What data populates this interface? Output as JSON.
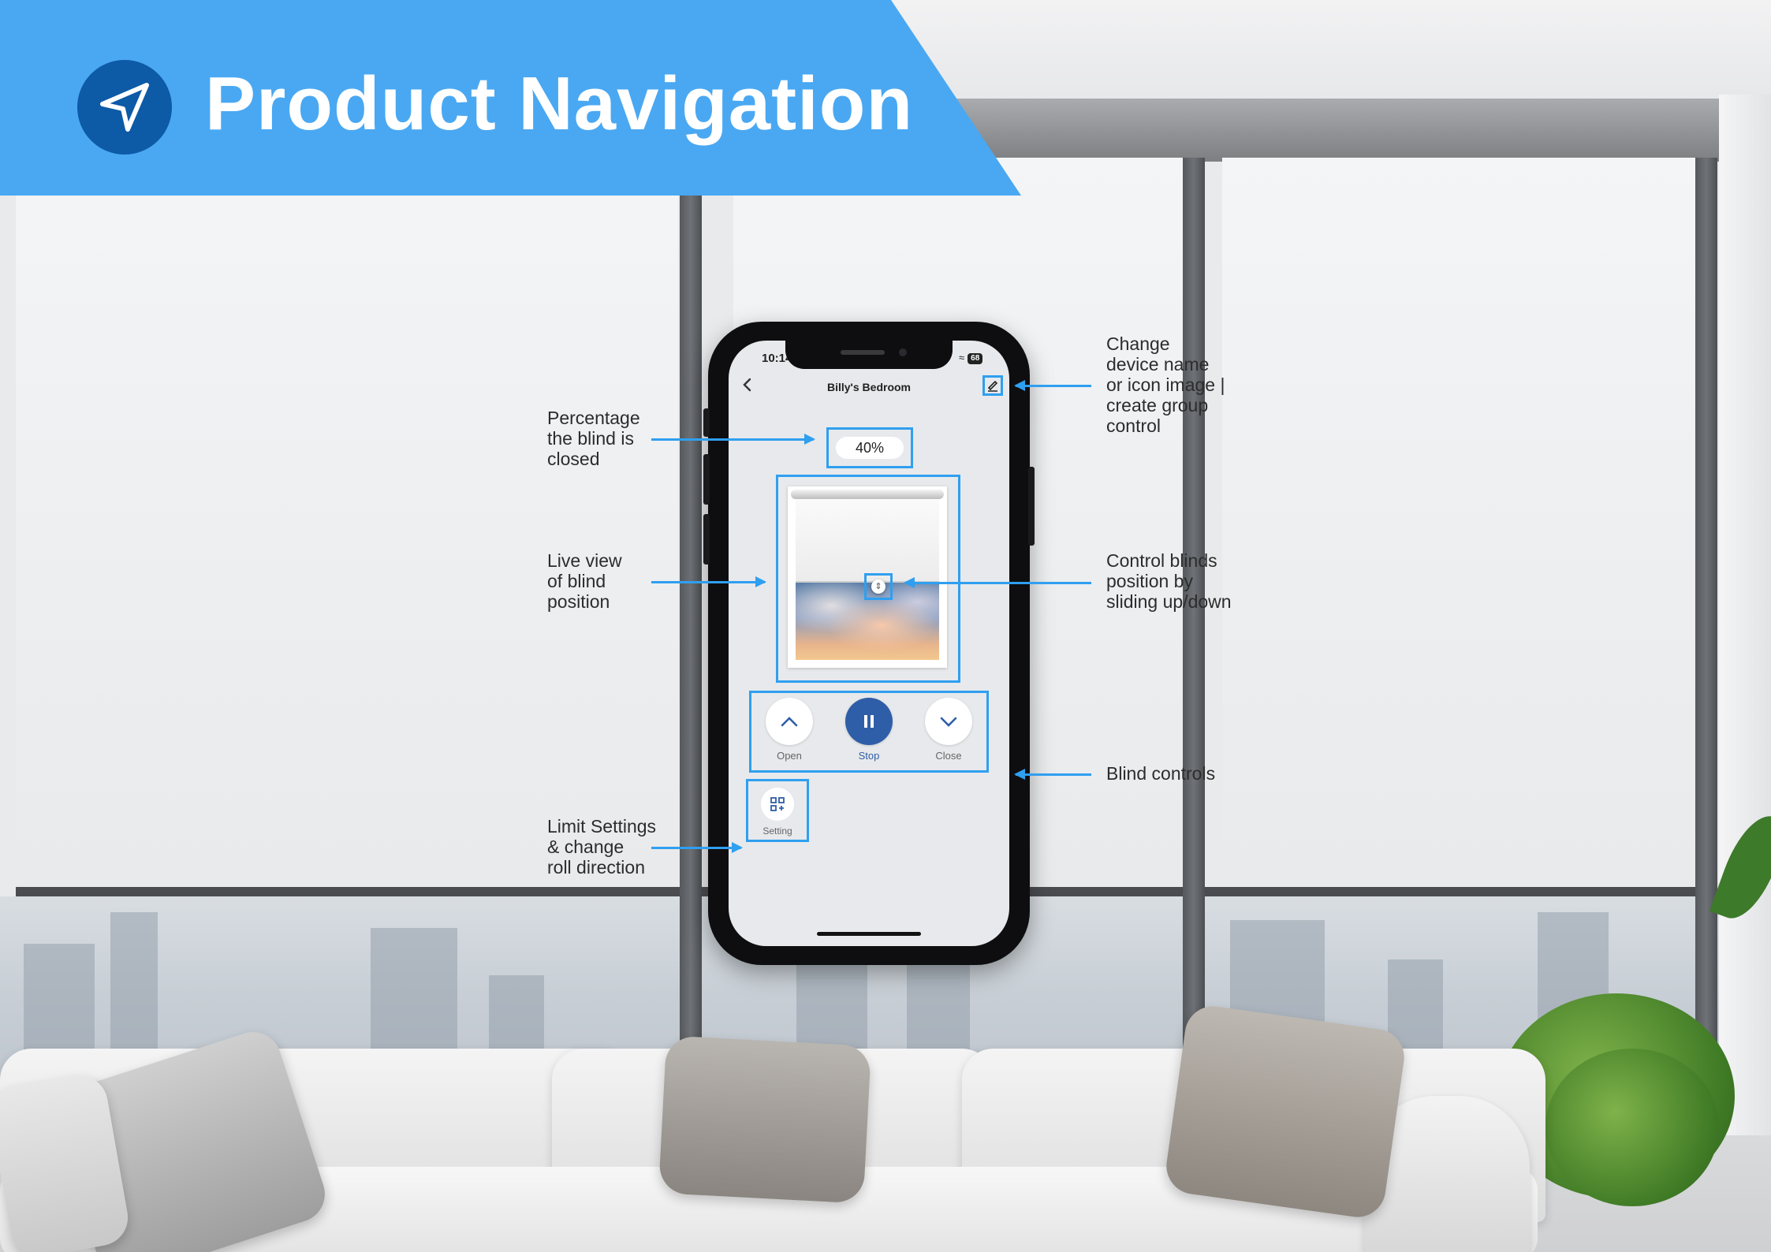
{
  "banner": {
    "title": "Product Navigation",
    "icon": "navigation-arrow-icon",
    "color": "#4aa8f2"
  },
  "phone": {
    "status_time": "10:14",
    "battery": "68",
    "device_name": "Billy's Bedroom",
    "percentage": "40%",
    "closed_percent": 40,
    "controls": {
      "open": "Open",
      "stop": "Stop",
      "close": "Close"
    },
    "setting_label": "Setting"
  },
  "annotations": {
    "edit": "Change\ndevice name\nor icon image |\ncreate group\ncontrol",
    "percentage": "Percentage\nthe blind is\nclosed",
    "live_view": "Live view\nof blind\nposition",
    "slider": "Control blinds\nposition by\nsliding up/down",
    "controls": "Blind controls",
    "settings": "Limit Settings\n& change\nroll direction"
  },
  "colors": {
    "highlight": "#2f9ff0",
    "stop_button": "#2f5ea8",
    "logo_circle": "#0d5aa7"
  }
}
